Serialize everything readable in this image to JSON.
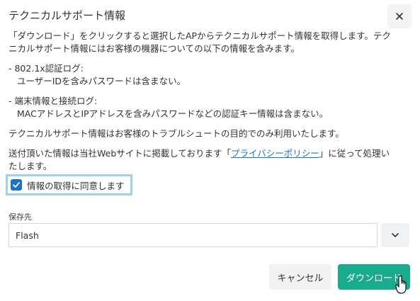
{
  "dialog": {
    "title": "テクニカルサポート情報",
    "close_icon": "close-icon"
  },
  "body": {
    "intro_line1": "「ダウンロード」をクリックすると選択したAPからテクニカルサポート情報を取得します。テク",
    "intro_line2": "ニカルサポート情報にはお客様の機器についての以下の情報を含みます。",
    "item1_title": "- 802.1x認証ログ:",
    "item1_detail": "ユーザーIDを含みパスワードは含まない。",
    "item2_title": "- 端末情報と接続ログ:",
    "item2_detail": "MACアドレスとIPアドレスを含みパスワードなどの認証キー情報は含まない。",
    "purpose": "テクニカルサポート情報はお客様のトラブルシュートの目的でのみ利用いたします。",
    "privacy_before": "送付頂いた情報は当社Webサイトに掲載しております「",
    "privacy_link": "プライバシーポリシー",
    "privacy_after": "」に従って処理い",
    "privacy_line2": "たします。"
  },
  "consent": {
    "label": "情報の取得に同意します",
    "checked": true
  },
  "destination": {
    "label": "保存先",
    "selected": "Flash",
    "toggle_icon": "chevron-down-icon"
  },
  "actions": {
    "cancel_label": "キャンセル",
    "download_label": "ダウンロード"
  },
  "colors": {
    "accent": "#1a73c8",
    "download_button": "#1aaa8c",
    "highlight_border": "#9fd3e3"
  }
}
